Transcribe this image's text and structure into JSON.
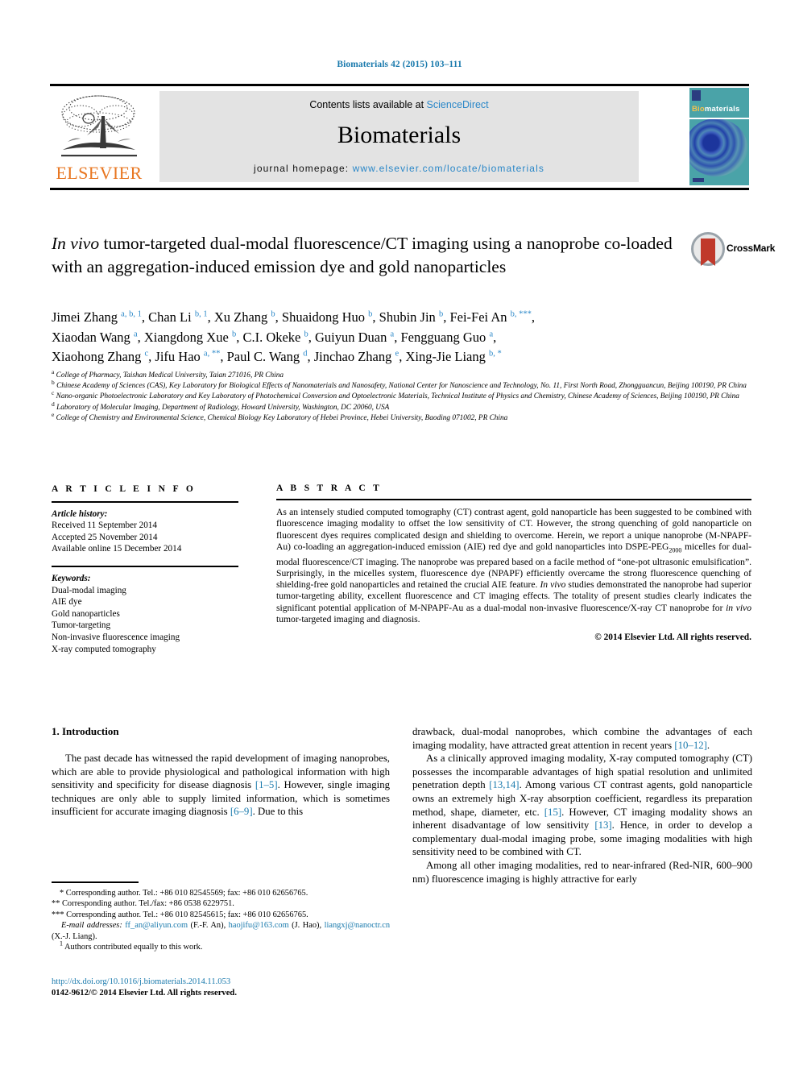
{
  "running_head": "Biomaterials 42 (2015) 103–111",
  "masthead": {
    "contents_prefix": "Contents lists available at ",
    "sciencedirect": "ScienceDirect",
    "journal_name": "Biomaterials",
    "homepage_label": "journal homepage: ",
    "homepage_url": "www.elsevier.com/locate/biomaterials",
    "publisher_logo_text": "ELSEVIER",
    "cover_title_first": "Bio",
    "cover_title_rest": "materials",
    "accent_blue": "#2a87c8",
    "accent_orange": "#e87722",
    "cover_teal": "#4aa3a8"
  },
  "article": {
    "title_part_italic": "In vivo",
    "title_rest": " tumor-targeted dual-modal fluorescence/CT imaging using a nanoprobe co-loaded with an aggregation-induced emission dye and gold nanoparticles",
    "crossmark_label": "CrossMark"
  },
  "authors_line_1": "Jimei Zhang a, b, 1, Chan Li b, 1, Xu Zhang b, Shuaidong Huo b, Shubin Jin b, Fei-Fei An b, ***,",
  "authors_line_2": "Xiaodan Wang a, Xiangdong Xue b, C.I. Okeke b, Guiyun Duan a, Fengguang Guo a,",
  "authors_line_3": "Xiaohong Zhang c, Jifu Hao a, **, Paul C. Wang d, Jinchao Zhang e, Xing-Jie Liang b, *",
  "affiliations": [
    {
      "mark": "a",
      "text": "College of Pharmacy, Taishan Medical University, Taian 271016, PR China"
    },
    {
      "mark": "b",
      "text": "Chinese Academy of Sciences (CAS), Key Laboratory for Biological Effects of Nanomaterials and Nanosafety, National Center for Nanoscience and Technology, No. 11, First North Road, Zhongguancun, Beijing 100190, PR China"
    },
    {
      "mark": "c",
      "text": "Nano-organic Photoelectronic Laboratory and Key Laboratory of Photochemical Conversion and Optoelectronic Materials, Technical Institute of Physics and Chemistry, Chinese Academy of Sciences, Beijing 100190, PR China"
    },
    {
      "mark": "d",
      "text": "Laboratory of Molecular Imaging, Department of Radiology, Howard University, Washington, DC 20060, USA"
    },
    {
      "mark": "e",
      "text": "College of Chemistry and Environmental Science, Chemical Biology Key Laboratory of Hebei Province, Hebei University, Baoding 071002, PR China"
    }
  ],
  "article_info": {
    "heading": "A R T I C L E  I N F O",
    "history_label": "Article history:",
    "history": [
      "Received 11 September 2014",
      "Accepted 25 November 2014",
      "Available online 15 December 2014"
    ],
    "keywords_label": "Keywords:",
    "keywords": [
      "Dual-modal imaging",
      "AIE dye",
      "Gold nanoparticles",
      "Tumor-targeting",
      "Non-invasive fluorescence imaging",
      "X-ray computed tomography"
    ]
  },
  "abstract": {
    "heading": "A B S T R A C T",
    "text_1": "As an intensely studied computed tomography (CT) contrast agent, gold nanoparticle has been suggested to be combined with fluorescence imaging modality to offset the low sensitivity of CT. However, the strong quenching of gold nanoparticle on fluorescent dyes requires complicated design and shielding to overcome. Herein, we report a unique nanoprobe (M-NPAPF-Au) co-loading an aggregation-induced emission (AIE) red dye and gold nanoparticles into DSPE-PEG",
    "sub_1": "2000",
    "text_2": " micelles for dual-modal fluorescence/CT imaging. The nanoprobe was prepared based on a facile method of “one-pot ultrasonic emulsification”. Surprisingly, in the micelles system, fluorescence dye (NPAPF) efficiently overcame the strong fluorescence quenching of shielding-free gold nanoparticles and retained the crucial AIE feature. ",
    "italic_1": "In vivo",
    "text_3": " studies demonstrated the nanoprobe had superior tumor-targeting ability, excellent fluorescence and CT imaging effects. The totality of present studies clearly indicates the significant potential application of M-NPAPF-Au as a dual-modal non-invasive fluorescence/X-ray CT nanoprobe for ",
    "italic_2": "in vivo",
    "text_4": " tumor-targeted imaging and diagnosis.",
    "copyright": "© 2014 Elsevier Ltd. All rights reserved."
  },
  "introduction": {
    "heading": "1. Introduction",
    "left_p1_a": "The past decade has witnessed the rapid development of imaging nanoprobes, which are able to provide physiological and pathological information with high sensitivity and specificity for disease diagnosis ",
    "left_ref1": "[1–5]",
    "left_p1_b": ". However, single imaging techniques are only able to supply limited information, which is sometimes insufficient for accurate imaging diagnosis ",
    "left_ref2": "[6–9]",
    "left_p1_c": ". Due to this",
    "right_p1_a": "drawback, dual-modal nanoprobes, which combine the advantages of each imaging modality, have attracted great attention in recent years ",
    "right_ref1": "[10–12]",
    "right_p1_b": ".",
    "right_p2_a": "As a clinically approved imaging modality, X-ray computed tomography (CT) possesses the incomparable advantages of high spatial resolution and unlimited penetration depth ",
    "right_ref2": "[13,14]",
    "right_p2_b": ". Among various CT contrast agents, gold nanoparticle owns an extremely high X-ray absorption coefficient, regardless its preparation method, shape, diameter, etc. ",
    "right_ref3": "[15]",
    "right_p2_c": ". However, CT imaging modality shows an inherent disadvantage of low sensitivity ",
    "right_ref4": "[13]",
    "right_p2_d": ". Hence, in order to develop a complementary dual-modal imaging probe, some imaging modalities with high sensitivity need to be combined with CT.",
    "right_p3": "Among all other imaging modalities, red to near-infrared (Red-NIR, 600–900 nm) fluorescence imaging is highly attractive for early"
  },
  "footnotes": {
    "fn1": "* Corresponding author. Tel.: +86 010 82545569; fax: +86 010 62656765.",
    "fn2": "** Corresponding author. Tel./fax: +86 0538 6229751.",
    "fn3": "*** Corresponding author. Tel.: +86 010 82545615; fax: +86 010 62656765.",
    "email_label": "E-mail addresses:",
    "email_1": "ff_an@aliyun.com",
    "email_1_owner": " (F.-F. An), ",
    "email_2": "haojifu@163.com",
    "email_2_owner": " (J. Hao), ",
    "email_3": "liangxj@nanoctr.cn",
    "email_3_owner": " (X.-J. Liang).",
    "fn_equal_mark": "1",
    "fn_equal": " Authors contributed equally to this work."
  },
  "footer": {
    "doi": "http://dx.doi.org/10.1016/j.biomaterials.2014.11.053",
    "issn": "0142-9612/© 2014 Elsevier Ltd. All rights reserved."
  }
}
